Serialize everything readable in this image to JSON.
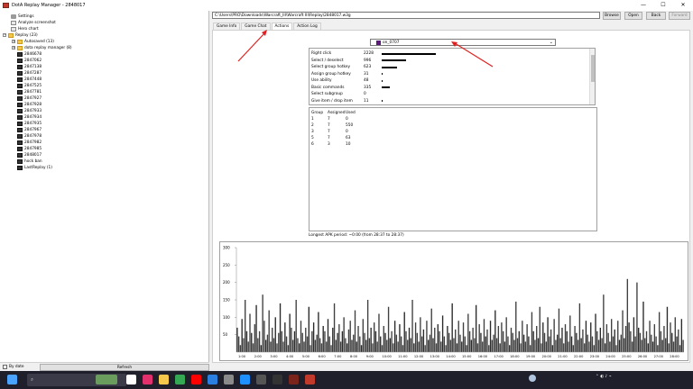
{
  "window": {
    "title": "DotA Replay Manager - 2848017",
    "controls": [
      "—",
      "☐",
      "✕"
    ]
  },
  "tree": {
    "items": [
      {
        "label": "Settings",
        "icon": "gear-icon"
      },
      {
        "label": "Analyze screenshot",
        "icon": "document-icon"
      },
      {
        "label": "Hero chart",
        "icon": "document-icon"
      },
      {
        "label": "Replay (23)",
        "icon": "folder-icon"
      },
      {
        "label": "Autosaved (13)",
        "icon": "folder-icon"
      },
      {
        "label": "dota replay manager (8)",
        "icon": "folder-icon"
      },
      {
        "label": "2846678",
        "icon": "replay-icon"
      },
      {
        "label": "2847062",
        "icon": "replay-icon"
      },
      {
        "label": "2847138",
        "icon": "replay-icon"
      },
      {
        "label": "2847287",
        "icon": "replay-icon"
      },
      {
        "label": "2847448",
        "icon": "replay-icon"
      },
      {
        "label": "2847525",
        "icon": "replay-icon"
      },
      {
        "label": "2847781",
        "icon": "replay-icon"
      },
      {
        "label": "2847927",
        "icon": "replay-icon"
      },
      {
        "label": "2847928",
        "icon": "replay-icon"
      },
      {
        "label": "2847933",
        "icon": "replay-icon"
      },
      {
        "label": "2847934",
        "icon": "replay-icon"
      },
      {
        "label": "2847935",
        "icon": "replay-icon"
      },
      {
        "label": "2847967",
        "icon": "replay-icon"
      },
      {
        "label": "2847978",
        "icon": "replay-icon"
      },
      {
        "label": "2847982",
        "icon": "replay-icon"
      },
      {
        "label": "2847985",
        "icon": "replay-icon"
      },
      {
        "label": "2848017",
        "icon": "replay-icon"
      },
      {
        "label": "hock ban",
        "icon": "replay-icon"
      },
      {
        "label": "LastReplay (1)",
        "icon": "replay-icon"
      }
    ]
  },
  "bottom": {
    "by_date_label": "By date",
    "refresh_label": "Refresh"
  },
  "toolbar": {
    "path": "C:\\Users\\PRO\\Downloads\\Warcraft_III\\Warcraft III\\Replay\\2848017.w3g",
    "browse": "Browse",
    "open": "Open",
    "back": "Back",
    "forward": "Forward"
  },
  "tabs": [
    "Game Info",
    "Game Chat",
    "Actions",
    "Action Log"
  ],
  "player": {
    "selected": "on_0707"
  },
  "actions": [
    {
      "label": "Right click",
      "value": 2228
    },
    {
      "label": "Select / deselect",
      "value": 996
    },
    {
      "label": "Select group hotkey",
      "value": 623
    },
    {
      "label": "Assign group hotkey",
      "value": 31
    },
    {
      "label": "Use ability",
      "value": 48
    },
    {
      "label": "Basic commands",
      "value": 335
    },
    {
      "label": "Select subgroup",
      "value": 0
    },
    {
      "label": "Give item / drop item",
      "value": 11
    }
  ],
  "groups": {
    "headers": [
      "Group",
      "Assigned",
      "Used"
    ],
    "rows": [
      [
        "1",
        "7",
        "0"
      ],
      [
        "2",
        "7",
        "550"
      ],
      [
        "3",
        "7",
        "0"
      ],
      [
        "5",
        "7",
        "63"
      ],
      [
        "6",
        "3",
        "10"
      ]
    ]
  },
  "apm_text": "Longest APK period: ~0:00 (from 28:37 to 28:37)",
  "chart_data": {
    "type": "bar",
    "ylim": [
      0,
      300
    ],
    "yticks": [
      "300",
      "250",
      "200",
      "150",
      "100",
      "50"
    ],
    "xticks": [
      "1:00",
      "2:00",
      "3:00",
      "4:00",
      "5:00",
      "6:00",
      "7:00",
      "8:00",
      "9:00",
      "10:00",
      "11:00",
      "12:00",
      "13:00",
      "14:00",
      "15:00",
      "16:00",
      "17:00",
      "18:00",
      "19:00",
      "20:00",
      "21:00",
      "22:00",
      "23:00",
      "24:00",
      "25:00",
      "26:00",
      "27:00",
      "28:00"
    ],
    "series_color": "#404040",
    "values": [
      70,
      45,
      20,
      95,
      40,
      150,
      60,
      30,
      110,
      55,
      25,
      80,
      135,
      40,
      60,
      20,
      165,
      90,
      35,
      50,
      120,
      30,
      70,
      40,
      100,
      25,
      55,
      140,
      60,
      30,
      85,
      45,
      20,
      110,
      70,
      35,
      60,
      150,
      40,
      25,
      90,
      55,
      30,
      70,
      45,
      130,
      20,
      60,
      85,
      35,
      50,
      115,
      40,
      25,
      75,
      60,
      30,
      95,
      45,
      20,
      70,
      140,
      35,
      55,
      80,
      30,
      60,
      100,
      40,
      25,
      65,
      90,
      35,
      50,
      120,
      30,
      75,
      45,
      20,
      95,
      55,
      35,
      150,
      40,
      70,
      25,
      85,
      60,
      30,
      110,
      45,
      20,
      75,
      55,
      35,
      130,
      40,
      60,
      25,
      90,
      50,
      30,
      80,
      45,
      20,
      115,
      60,
      35,
      70,
      40,
      150,
      25,
      85,
      55,
      30,
      100,
      45,
      65,
      20,
      90,
      35,
      50,
      125,
      40,
      70,
      25,
      80,
      60,
      30,
      105,
      45,
      20,
      75,
      55,
      35,
      140,
      40,
      65,
      25,
      90,
      50,
      30,
      85,
      45,
      20,
      110,
      60,
      35,
      70,
      40,
      135,
      25,
      80,
      55,
      30,
      95,
      45,
      65,
      20,
      90,
      35,
      50,
      120,
      40,
      75,
      25,
      85,
      60,
      30,
      100,
      45,
      20,
      70,
      55,
      35,
      145,
      40,
      60,
      25,
      90,
      50,
      30,
      80,
      45,
      20,
      115,
      60,
      35,
      75,
      40,
      130,
      25,
      85,
      55,
      30,
      100,
      45,
      65,
      20,
      95,
      35,
      50,
      125,
      40,
      70,
      25,
      80,
      60,
      30,
      105,
      45,
      20,
      75,
      55,
      35,
      140,
      40,
      65,
      25,
      90,
      50,
      30,
      85,
      45,
      20,
      110,
      60,
      35,
      70,
      40,
      165,
      25,
      80,
      55,
      30,
      95,
      45,
      65,
      20,
      90,
      35,
      50,
      120,
      40,
      75,
      210,
      85,
      60,
      30,
      100,
      45,
      200,
      70,
      55,
      35,
      145,
      40,
      60,
      25,
      90,
      50,
      30,
      80,
      45,
      20,
      115,
      60,
      35,
      75,
      40,
      130,
      25,
      85,
      55,
      30,
      100,
      45,
      65,
      20,
      95,
      35
    ]
  }
}
